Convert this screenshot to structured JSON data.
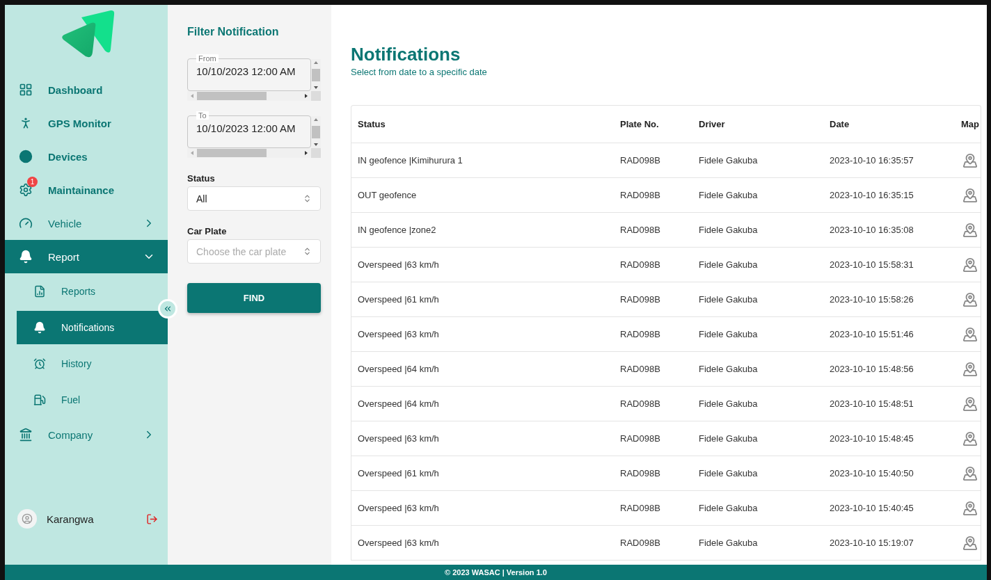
{
  "sidebar": {
    "items": [
      {
        "label": "Dashboard",
        "kind": "item",
        "selected": false
      },
      {
        "label": "GPS Monitor",
        "kind": "item",
        "selected": false
      },
      {
        "label": "Devices",
        "kind": "item",
        "selected": false
      },
      {
        "label": "Maintainance",
        "kind": "item",
        "selected": false,
        "badge": "1"
      },
      {
        "label": "Vehicle",
        "kind": "group",
        "selected": false,
        "expanded": false
      },
      {
        "label": "Report",
        "kind": "group",
        "selected": true,
        "expanded": true,
        "children": [
          {
            "label": "Reports",
            "selected": false
          },
          {
            "label": "Notifications",
            "selected": true
          },
          {
            "label": "History",
            "selected": false
          },
          {
            "label": "Fuel",
            "selected": false
          }
        ]
      },
      {
        "label": "Company",
        "kind": "group",
        "selected": false,
        "expanded": false
      }
    ],
    "user": {
      "name": "Karangwa"
    }
  },
  "filter": {
    "title": "Filter Notification",
    "from": {
      "label": "From",
      "value": "10/10/2023 12:00 AM"
    },
    "to": {
      "label": "To",
      "value": "10/10/2023 12:00 AM"
    },
    "status": {
      "label": "Status",
      "value": "All"
    },
    "car_plate": {
      "label": "Car Plate",
      "placeholder": "Choose the car plate"
    },
    "button": "FIND"
  },
  "main": {
    "title": "Notifications",
    "subtitle": "Select from date to a specific date"
  },
  "table": {
    "columns": [
      "Status",
      "Plate No.",
      "Driver",
      "Date",
      "Map"
    ],
    "rows": [
      [
        "IN geofence |Kimihurura 1",
        "RAD098B",
        "Fidele Gakuba",
        "2023-10-10 16:35:57"
      ],
      [
        "OUT geofence",
        "RAD098B",
        "Fidele Gakuba",
        "2023-10-10 16:35:15"
      ],
      [
        "IN geofence |zone2",
        "RAD098B",
        "Fidele Gakuba",
        "2023-10-10 16:35:08"
      ],
      [
        "Overspeed |63 km/h",
        "RAD098B",
        "Fidele Gakuba",
        "2023-10-10 15:58:31"
      ],
      [
        "Overspeed |61 km/h",
        "RAD098B",
        "Fidele Gakuba",
        "2023-10-10 15:58:26"
      ],
      [
        "Overspeed |63 km/h",
        "RAD098B",
        "Fidele Gakuba",
        "2023-10-10 15:51:46"
      ],
      [
        "Overspeed |64 km/h",
        "RAD098B",
        "Fidele Gakuba",
        "2023-10-10 15:48:56"
      ],
      [
        "Overspeed |64 km/h",
        "RAD098B",
        "Fidele Gakuba",
        "2023-10-10 15:48:51"
      ],
      [
        "Overspeed |63 km/h",
        "RAD098B",
        "Fidele Gakuba",
        "2023-10-10 15:48:45"
      ],
      [
        "Overspeed |61 km/h",
        "RAD098B",
        "Fidele Gakuba",
        "2023-10-10 15:40:50"
      ],
      [
        "Overspeed |63 km/h",
        "RAD098B",
        "Fidele Gakuba",
        "2023-10-10 15:40:45"
      ],
      [
        "Overspeed |63 km/h",
        "RAD098B",
        "Fidele Gakuba",
        "2023-10-10 15:19:07"
      ]
    ]
  },
  "footer": {
    "text": "© 2023 WASAC | Version 1.0"
  }
}
